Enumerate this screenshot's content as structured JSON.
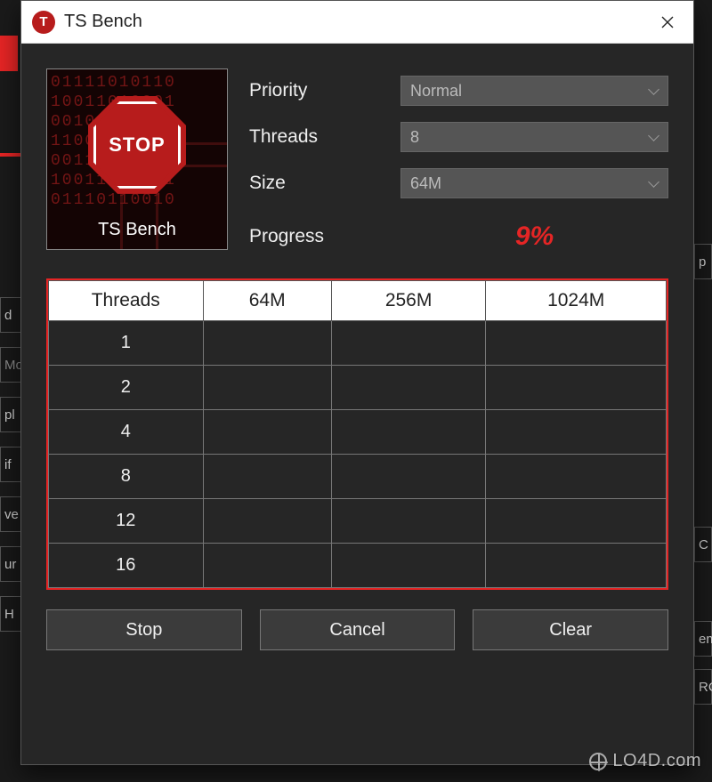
{
  "window": {
    "title": "TS Bench",
    "icon_letter": "T"
  },
  "logo": {
    "stop_text": "STOP",
    "caption": "TS Bench"
  },
  "fields": {
    "priority": {
      "label": "Priority",
      "value": "Normal"
    },
    "threads": {
      "label": "Threads",
      "value": "8"
    },
    "size": {
      "label": "Size",
      "value": "64M"
    },
    "progress": {
      "label": "Progress",
      "value": "9%"
    }
  },
  "table": {
    "headers": [
      "Threads",
      "64M",
      "256M",
      "1024M"
    ],
    "rows": [
      {
        "threads": "1",
        "c64": "",
        "c256": "",
        "c1024": ""
      },
      {
        "threads": "2",
        "c64": "",
        "c256": "",
        "c1024": ""
      },
      {
        "threads": "4",
        "c64": "",
        "c256": "",
        "c1024": ""
      },
      {
        "threads": "8",
        "c64": "",
        "c256": "",
        "c1024": ""
      },
      {
        "threads": "12",
        "c64": "",
        "c256": "",
        "c1024": ""
      },
      {
        "threads": "16",
        "c64": "",
        "c256": "",
        "c1024": ""
      }
    ]
  },
  "buttons": {
    "stop": "Stop",
    "cancel": "Cancel",
    "clear": "Clear"
  },
  "watermark": "LO4D.com",
  "background_labels": [
    "d",
    "Mo",
    "pl",
    "if",
    "ve",
    "ur",
    "H",
    "p",
    "C",
    "em",
    "RC"
  ]
}
